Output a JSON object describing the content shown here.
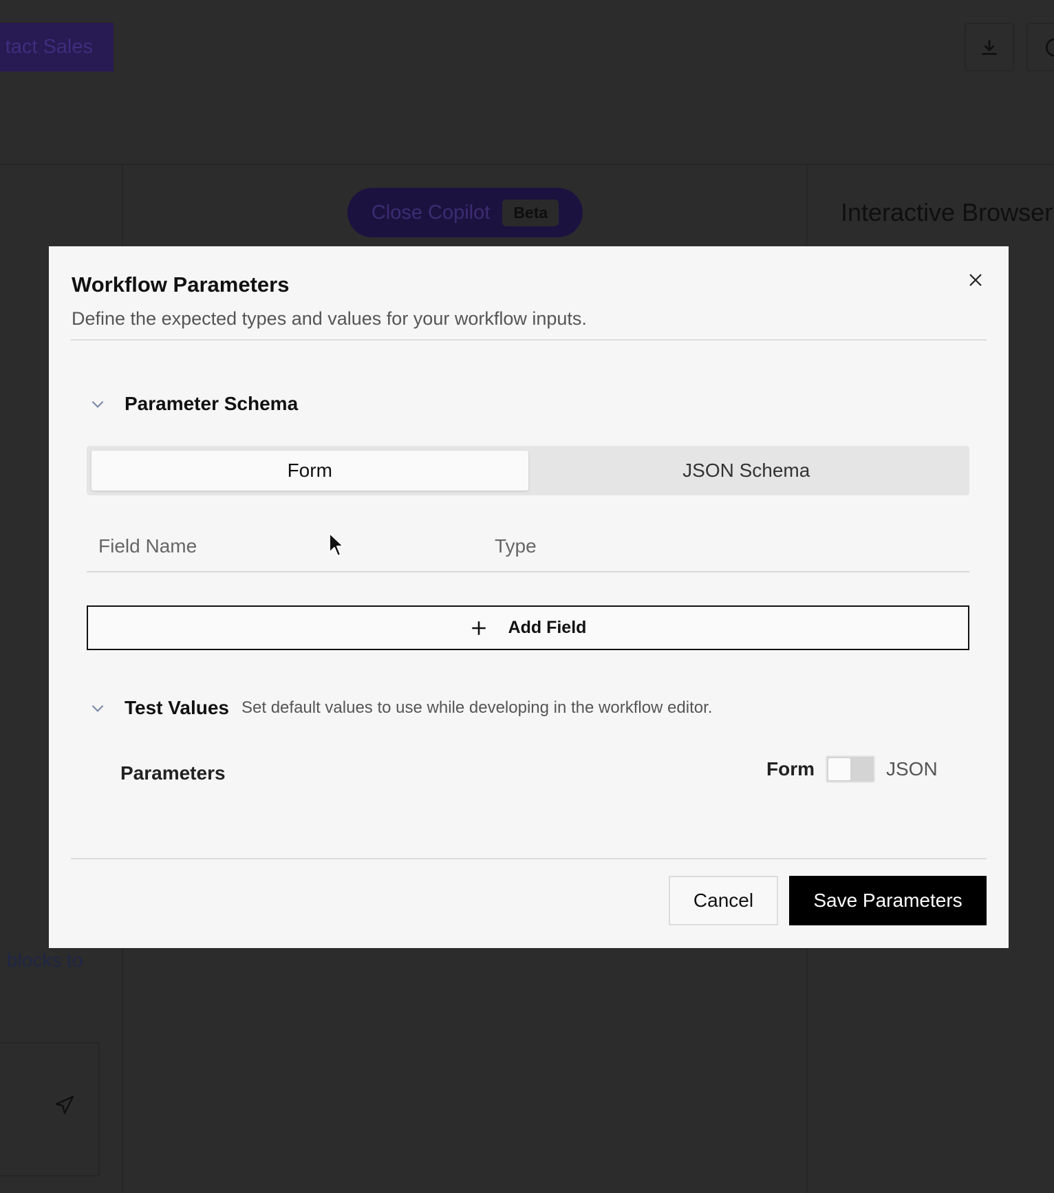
{
  "background": {
    "contact_sales": "tact Sales",
    "copilot_label": "Close Copilot",
    "copilot_badge": "Beta",
    "panel_title": "Interactive Browser",
    "chat_hint": "blocks to"
  },
  "modal": {
    "title": "Workflow Parameters",
    "description": "Define the expected types and values for your workflow inputs.",
    "schema_section": {
      "title": "Parameter Schema",
      "tabs": [
        {
          "label": "Form",
          "active": true
        },
        {
          "label": "JSON Schema",
          "active": false
        }
      ],
      "columns": [
        "Field Name",
        "Type"
      ],
      "add_field_label": "Add Field"
    },
    "test_section": {
      "title": "Test Values",
      "subtitle": "Set default values to use while developing in the workflow editor.",
      "parameters_label": "Parameters",
      "toggle_left": "Form",
      "toggle_right": "JSON"
    },
    "cancel_label": "Cancel",
    "save_label": "Save Parameters"
  },
  "colors": {
    "overlay": "#2c2c2c",
    "modal_bg": "#f6f6f6",
    "primary_button": "#000000"
  }
}
